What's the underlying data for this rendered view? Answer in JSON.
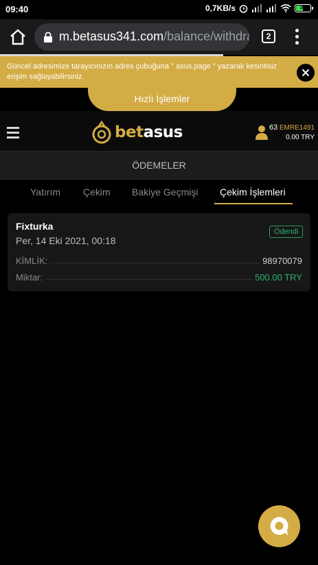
{
  "status_bar": {
    "time": "09:40",
    "net_speed": "0,7KB/s",
    "battery_level": "32",
    "battery_color": "#3ddc55"
  },
  "browser": {
    "url_domain": "m.betasus341.com",
    "url_path": "/balance/withdraw",
    "tab_count": "2"
  },
  "notice": {
    "text": "Güncel adresimize tarayıcınızın adres çubuğuna \" asus.page \" yazarak kesintisiz erişim sağlayabilirsiniz."
  },
  "quick_actions": {
    "label": "Hızlı İşlemler"
  },
  "header": {
    "logo_bet": "bet",
    "logo_asus": "asus",
    "user_number": "63",
    "username": "EMRE1491",
    "balance": "0.00 TRY",
    "accent_color": "#d4ac45"
  },
  "payments": {
    "title": "ÖDEMELER"
  },
  "tabs": [
    {
      "label": "Yatırım"
    },
    {
      "label": "Çekim"
    },
    {
      "label": "Bakiye Geçmişi"
    },
    {
      "label": "Çekim İşlemleri",
      "active": true
    }
  ],
  "withdrawal": {
    "method": "Fixturka",
    "date": "Per, 14 Eki 2021, 00:18",
    "status": "Ödendi",
    "id_label": "KİMLİK:",
    "id_value": "98970079",
    "amount_label": "Miktar:",
    "amount_value": "500.00 TRY",
    "status_color": "#2fb36e"
  }
}
